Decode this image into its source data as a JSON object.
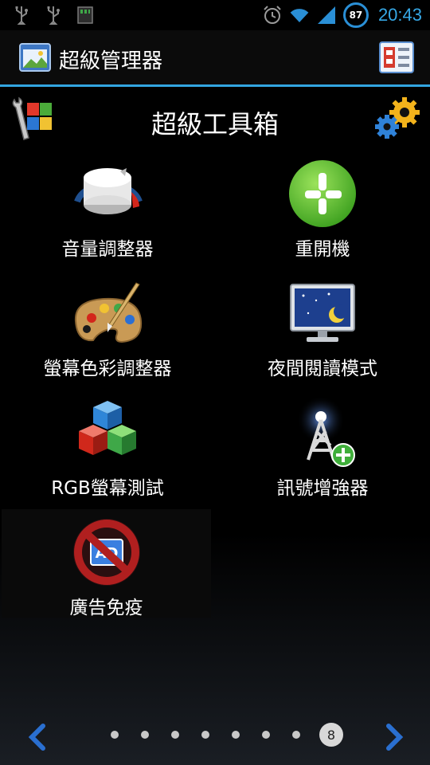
{
  "status_bar": {
    "left_icons": [
      "usb-icon",
      "usb-icon",
      "sd-card-icon"
    ],
    "right_icons": [
      "alarm-icon",
      "wifi-icon",
      "signal-icon"
    ],
    "battery_percent": "87",
    "time": "20:43",
    "accent_color": "#36a8e6"
  },
  "action_bar": {
    "title": "超級管理器",
    "app_icon": "app-window-icon",
    "menu_icon": "grid-menu-icon",
    "underline_color": "#33a5e0"
  },
  "toolbox": {
    "title": "超級工具箱",
    "left_icon": "wrench-windows-icon",
    "right_icon": "gears-icon"
  },
  "tiles": [
    {
      "label": "音量調整器",
      "icon": "volume-knob-icon"
    },
    {
      "label": "重開機",
      "icon": "restart-icon"
    },
    {
      "label": "螢幕色彩調整器",
      "icon": "paint-palette-icon"
    },
    {
      "label": "夜間閱讀模式",
      "icon": "night-monitor-icon"
    },
    {
      "label": "RGB螢幕測試",
      "icon": "rgb-cubes-icon"
    },
    {
      "label": "訊號增強器",
      "icon": "signal-tower-icon"
    },
    {
      "label": "廣告免疫",
      "icon": "ad-block-icon"
    }
  ],
  "pager": {
    "current_page": "8",
    "total_dots": 8
  }
}
